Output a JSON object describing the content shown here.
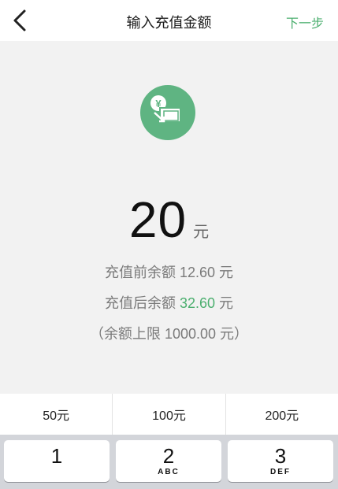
{
  "navbar": {
    "title": "输入充值金额",
    "next_label": "下一步",
    "back_icon": "chevron-left-icon"
  },
  "main": {
    "icon": "recharge-yen-icon",
    "amount": "20",
    "unit": "元",
    "balance_before": {
      "label": "充值前余额",
      "value": "12.60",
      "unit": "元"
    },
    "balance_after": {
      "label": "充值后余额",
      "value": "32.60",
      "unit": "元"
    },
    "limit": {
      "open": "（",
      "label": "余额上限",
      "value": "1000.00",
      "unit": "元",
      "close": "）"
    }
  },
  "quick_amounts": [
    {
      "label": "50元"
    },
    {
      "label": "100元"
    },
    {
      "label": "200元"
    }
  ],
  "keypad": {
    "keys": [
      {
        "digit": "1",
        "letters": ""
      },
      {
        "digit": "2",
        "letters": "ABC"
      },
      {
        "digit": "3",
        "letters": "DEF"
      }
    ]
  },
  "colors": {
    "accent": "#4caf6f",
    "icon_bg": "#5fb482",
    "background": "#f2f2f2"
  }
}
